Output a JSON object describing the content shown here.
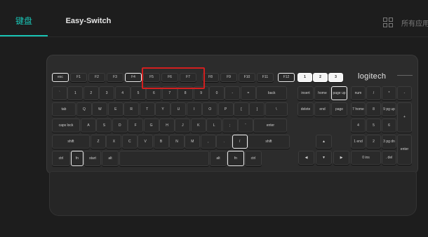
{
  "tabs": {
    "keyboard": "键盘",
    "easy_switch": "Easy-Switch"
  },
  "header": {
    "all_apps": "所有应用"
  },
  "icons": {
    "apps_grid": "grid-icon"
  },
  "keyboard": {
    "brand": "logitech",
    "fn_row": [
      "esc",
      "F1",
      "F2",
      "F3",
      "F4",
      "F5",
      "F6",
      "F7",
      "F8",
      "F9",
      "F10",
      "F11",
      "F12"
    ],
    "easy_switch_keys": [
      "1",
      "2",
      "3"
    ],
    "row1": [
      "`",
      "1",
      "2",
      "3",
      "4",
      "5",
      "6",
      "7",
      "8",
      "9",
      "0",
      "-",
      "=",
      "back"
    ],
    "nav1": [
      "insert",
      "home",
      "page up"
    ],
    "numpad1": [
      "num lock",
      "/",
      "*",
      "-"
    ],
    "row2": [
      "tab",
      "Q",
      "W",
      "E",
      "R",
      "T",
      "Y",
      "U",
      "I",
      "O",
      "P",
      "[",
      "]",
      "\\"
    ],
    "nav2": [
      "delete",
      "end",
      "page down"
    ],
    "numpad2": [
      "7 home",
      "8",
      "9 pg up",
      "+"
    ],
    "row3": [
      "caps lock",
      "A",
      "S",
      "D",
      "F",
      "G",
      "H",
      "J",
      "K",
      "L",
      ";",
      "'",
      "enter"
    ],
    "numpad3": [
      "4",
      "5",
      "6"
    ],
    "row4": [
      "shift",
      "Z",
      "X",
      "C",
      "V",
      "B",
      "N",
      "M",
      ",",
      ".",
      "/",
      "shift"
    ],
    "numpad4": [
      "1 end",
      "2",
      "3 pg dn",
      "enter"
    ],
    "row5": [
      "ctrl",
      "fn",
      "start",
      "alt",
      "",
      "alt",
      "fn",
      "ctrl"
    ],
    "numpad5": [
      "0 ins",
      ". del"
    ]
  },
  "colors": {
    "accent": "#19c3b4",
    "highlight": "#d21f1f"
  }
}
